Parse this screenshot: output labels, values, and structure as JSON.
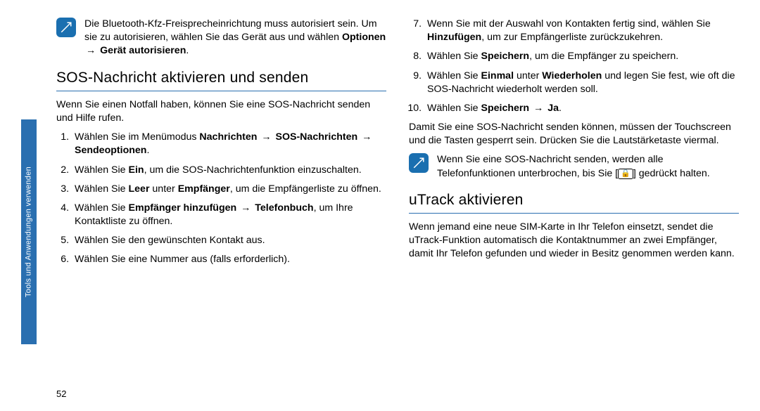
{
  "sideTab": "Tools und Anwendungen verwenden",
  "pageNumber": "52",
  "col1": {
    "note1_a": "Die Bluetooth-Kfz-Freisprecheinrichtung muss autorisiert sein. Um sie zu autorisieren, wählen Sie das Gerät aus und wählen ",
    "note1_b1": "Optionen",
    "note1_arrow": " → ",
    "note1_b2": "Gerät autorisieren",
    "note1_c": ".",
    "heading1": "SOS-Nachricht aktivieren und senden",
    "intro": "Wenn Sie einen Notfall haben, können Sie eine SOS-Nachricht senden und Hilfe rufen.",
    "step1_a": "Wählen Sie im Menümodus ",
    "step1_b1": "Nachrichten",
    "step1_b2": "SOS-Nachrichten",
    "step1_b3": "Sendeoptionen",
    "step1_c": ".",
    "step2_a": "Wählen Sie ",
    "step2_b": "Ein",
    "step2_c": ", um die SOS-Nachrichtenfunktion einzuschalten.",
    "step3_a": "Wählen Sie ",
    "step3_b1": "Leer",
    "step3_m": " unter ",
    "step3_b2": "Empfänger",
    "step3_c": ", um die Empfängerliste zu öffnen.",
    "step4_a": "Wählen Sie ",
    "step4_b1": "Empfänger hinzufügen",
    "step4_b2": "Telefonbuch",
    "step4_c": ", um Ihre Kontaktliste zu öffnen.",
    "step5": "Wählen Sie den gewünschten Kontakt aus.",
    "step6": "Wählen Sie eine Nummer aus (falls erforderlich)."
  },
  "col2": {
    "step7_a": "Wenn Sie mit der Auswahl von Kontakten fertig sind, wählen Sie ",
    "step7_b": "Hinzufügen",
    "step7_c": ", um zur Empfängerliste zurückzukehren.",
    "step8_a": "Wählen Sie ",
    "step8_b": "Speichern",
    "step8_c": ", um die Empfänger zu speichern.",
    "step9_a": "Wählen Sie ",
    "step9_b1": "Einmal",
    "step9_m": " unter ",
    "step9_b2": "Wiederholen",
    "step9_c": " und legen Sie fest, wie oft die SOS-Nachricht wiederholt werden soll.",
    "step10_a": "Wählen Sie ",
    "step10_b1": "Speichern",
    "step10_b2": "Ja",
    "step10_c": ".",
    "para1": "Damit Sie eine SOS-Nachricht senden können, müssen der Touchscreen und die Tasten gesperrt sein. Drücken Sie die Lautstärketaste viermal.",
    "note2_a": "Wenn Sie eine SOS-Nachricht senden, werden alle Telefonfunktionen unterbrochen, bis Sie [",
    "note2_lock": "🔒",
    "note2_b": "] gedrückt halten.",
    "heading2": "uTrack aktivieren",
    "para2": "Wenn jemand eine neue SIM-Karte in Ihr Telefon einsetzt, sendet die uTrack-Funktion automatisch die Kontaktnummer an zwei Empfänger, damit Ihr Telefon gefunden und wieder in Besitz genommen werden kann."
  }
}
